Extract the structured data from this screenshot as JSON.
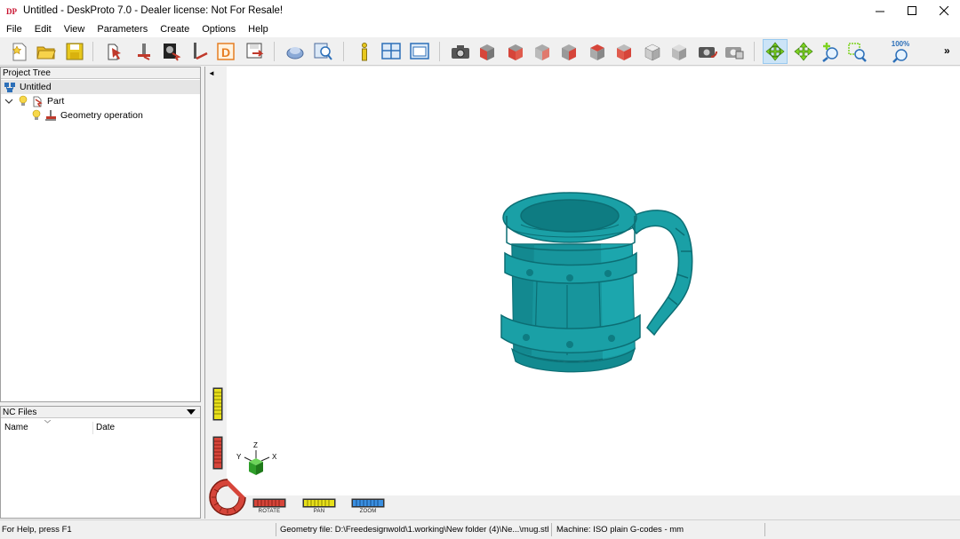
{
  "window": {
    "title": "Untitled - DeskProto 7.0 - Dealer license: Not For Resale!",
    "app_icon_text": "DP"
  },
  "menu": [
    "File",
    "Edit",
    "View",
    "Parameters",
    "Create",
    "Options",
    "Help"
  ],
  "toolbar": {
    "zoom_label": "100%",
    "overflow": "»",
    "buttons": [
      "new-project",
      "open-project",
      "save-project",
      "part-params",
      "operation-params",
      "image-params",
      "vector-params",
      "drill-params",
      "save-geometry",
      "view-params",
      "view-zoom-params",
      "info",
      "split-view",
      "view-window",
      "camera-view",
      "view-front",
      "view-right",
      "view-back",
      "view-left",
      "view-top",
      "view-bottom",
      "view-iso-shaded",
      "view-iso-grey",
      "snapshot-rotate",
      "snapshot",
      "rotate-mode",
      "pan-mode",
      "zoom-mode",
      "zoom-window",
      "zoom-100"
    ]
  },
  "tree": {
    "header": "Project Tree",
    "root": "Untitled",
    "part": "Part",
    "operation": "Geometry operation"
  },
  "nc_files": {
    "header": "NC Files",
    "columns": [
      "Name",
      "Date"
    ]
  },
  "viewport": {
    "nav_labels": [
      "ROTATE",
      "PAN",
      "ZOOM"
    ],
    "axes": {
      "x": "X",
      "y": "Y",
      "z": "Z"
    },
    "model_color": "#1aa0a6",
    "collapse_arrow": "◄"
  },
  "status": {
    "help": "For Help, press F1",
    "geometry": "Geometry file: D:\\Freedesignwold\\1.working\\New folder (4)\\Ne...\\mug.stl",
    "machine": "Machine: ISO plain G-codes - mm"
  }
}
